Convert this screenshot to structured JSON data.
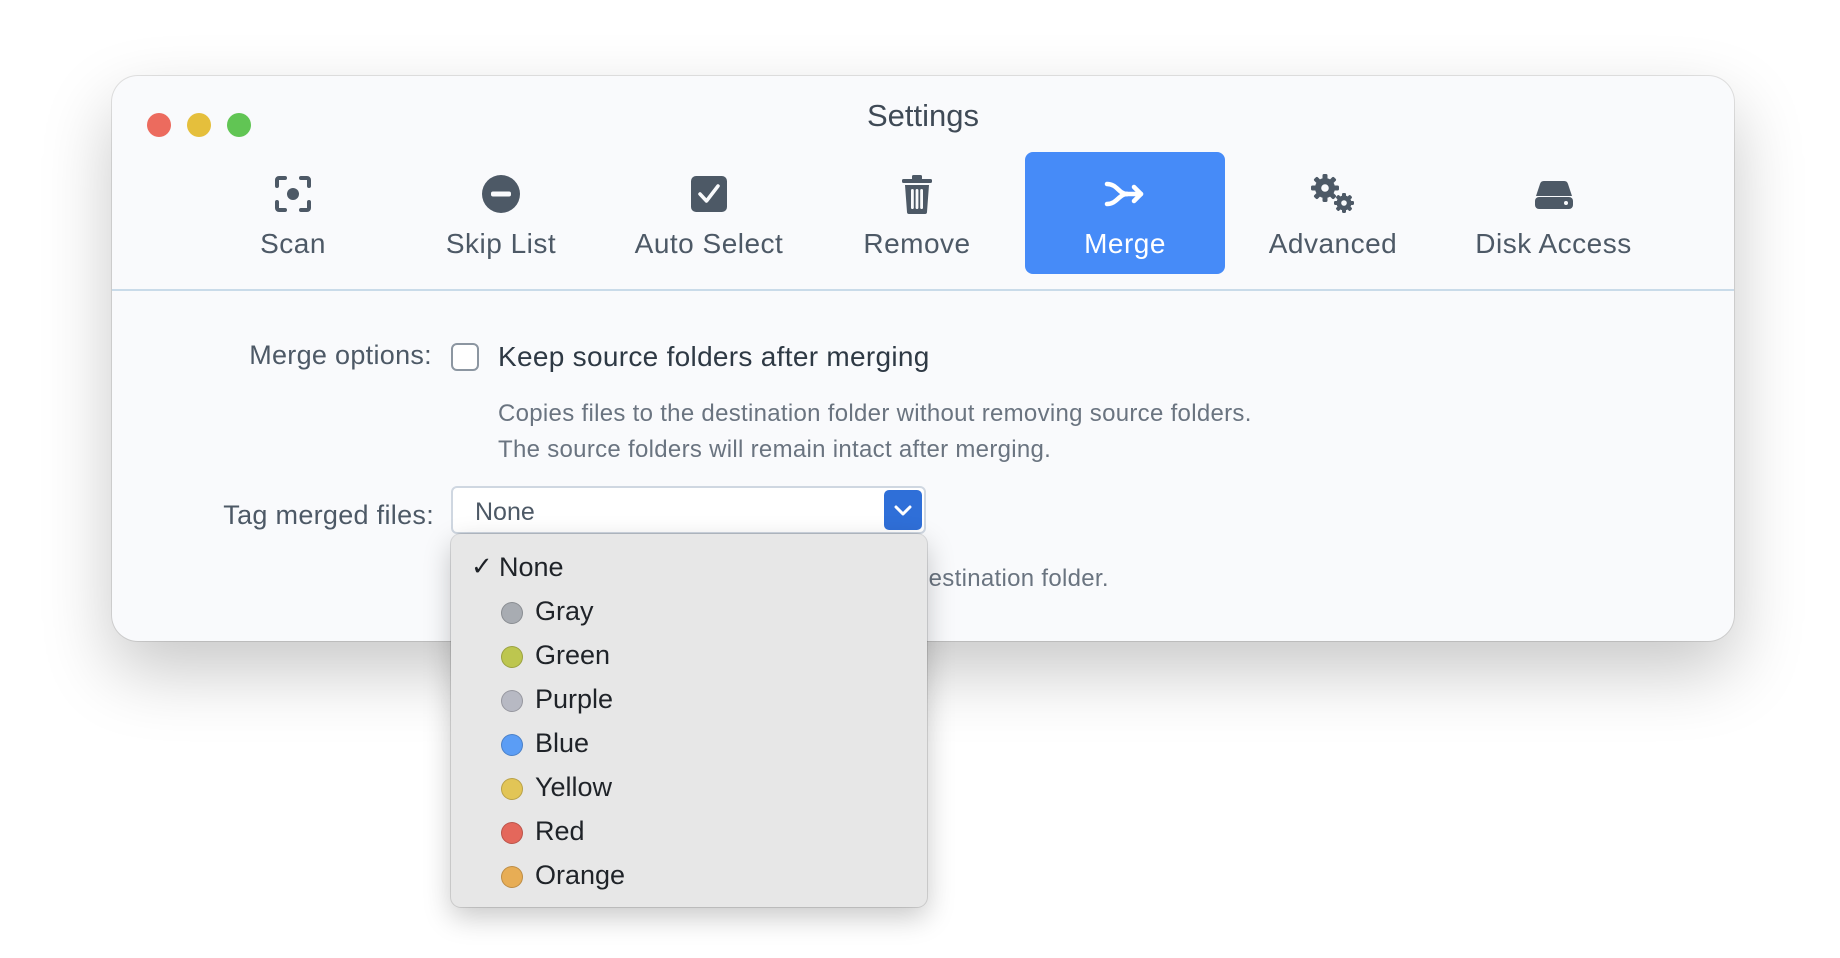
{
  "window": {
    "title": "Settings"
  },
  "toolbar": {
    "items": [
      {
        "label": "Scan",
        "icon": "scan-icon"
      },
      {
        "label": "Skip List",
        "icon": "minus-circle-icon"
      },
      {
        "label": "Auto Select",
        "icon": "checkbox-checked-icon"
      },
      {
        "label": "Remove",
        "icon": "trash-icon"
      },
      {
        "label": "Merge",
        "icon": "merge-arrow-icon",
        "active": true
      },
      {
        "label": "Advanced",
        "icon": "gears-icon"
      },
      {
        "label": "Disk Access",
        "icon": "disk-drive-icon"
      }
    ]
  },
  "merge_options": {
    "label": "Merge options:",
    "checkbox_label": "Keep source folders after merging",
    "checked": false,
    "desc_line1": "Copies files to the destination folder without removing source folders.",
    "desc_line2": "The source folders will remain intact after merging."
  },
  "tag_merged": {
    "label": "Tag merged files:",
    "selected": "None",
    "desc_visible": "destination folder."
  },
  "dropdown": {
    "selected_check": "✓",
    "options": [
      {
        "label": "None",
        "color": null,
        "selected": true
      },
      {
        "label": "Gray",
        "color": "#a8acb2"
      },
      {
        "label": "Green",
        "color": "#bdc64f"
      },
      {
        "label": "Purple",
        "color": "#b7b9c3"
      },
      {
        "label": "Blue",
        "color": "#5b9df5"
      },
      {
        "label": "Yellow",
        "color": "#e2c556"
      },
      {
        "label": "Red",
        "color": "#e4675b"
      },
      {
        "label": "Orange",
        "color": "#e7ad55"
      }
    ]
  },
  "colors": {
    "accent": "#468bf8",
    "select_arrow": "#2f6fd8"
  }
}
